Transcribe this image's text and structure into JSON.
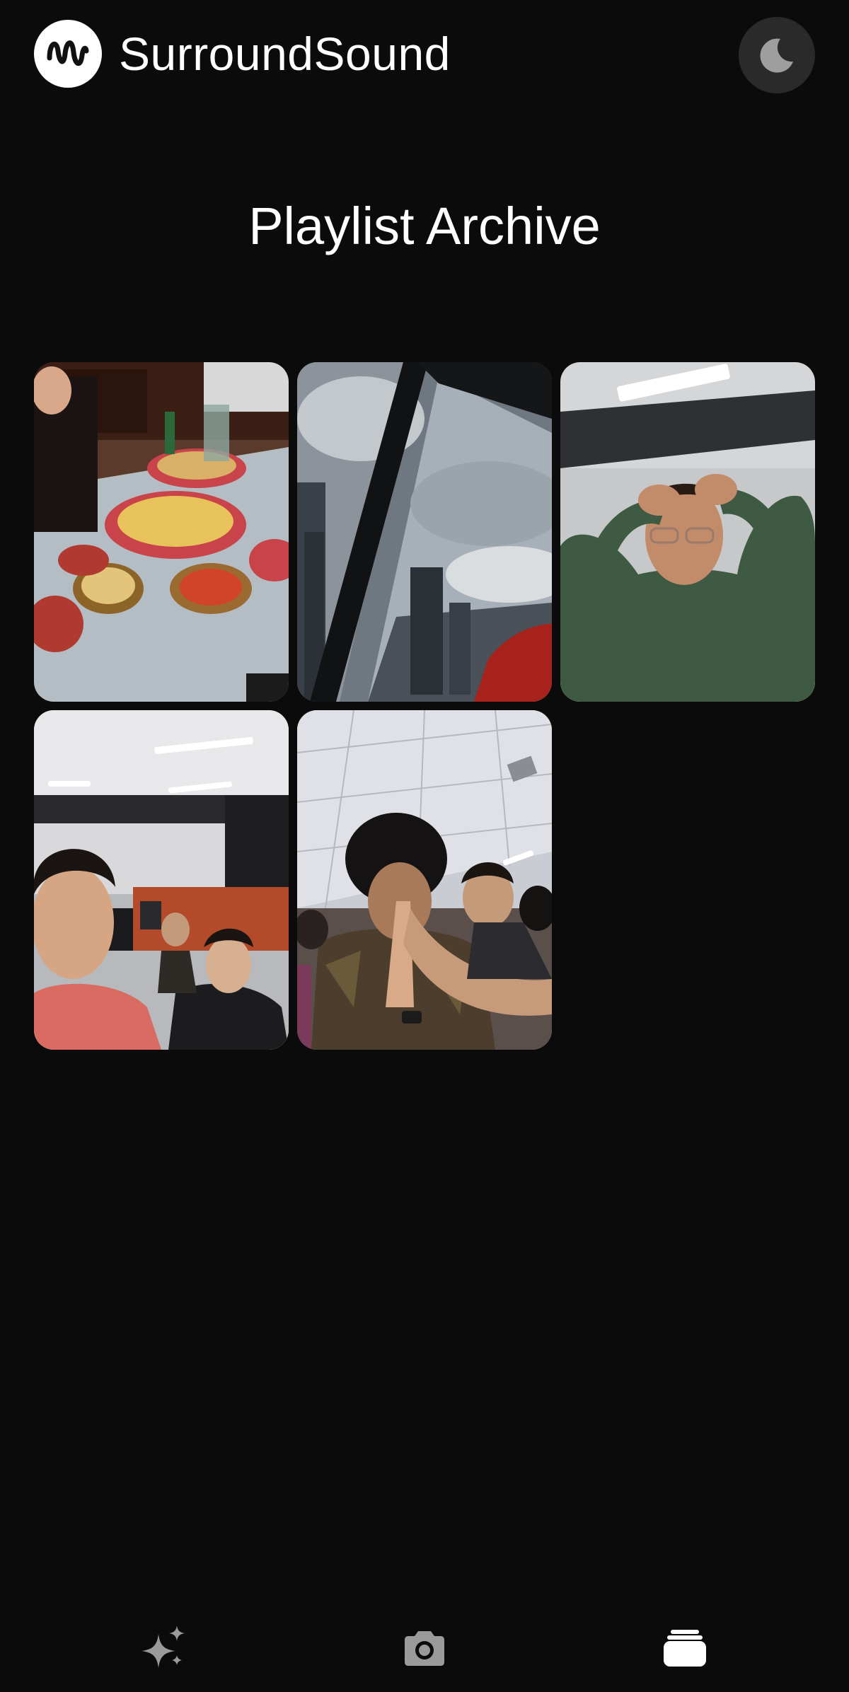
{
  "app": {
    "name": "SurroundSound",
    "logo_icon": "waveform-logo-icon",
    "theme_toggle_icon": "moon-icon"
  },
  "page": {
    "title": "Playlist Archive"
  },
  "archive": {
    "items": [
      {
        "name": "archive-photo-1",
        "subject": "restaurant-table-selfie"
      },
      {
        "name": "archive-photo-2",
        "subject": "city-skyline-window"
      },
      {
        "name": "archive-photo-3",
        "subject": "person-green-sweater"
      },
      {
        "name": "archive-photo-4",
        "subject": "computer-lab-selfie"
      },
      {
        "name": "archive-photo-5",
        "subject": "crowd-praying-hands"
      }
    ]
  },
  "nav": {
    "items": [
      {
        "icon": "sparkles-icon",
        "active": false
      },
      {
        "icon": "camera-icon",
        "active": false
      },
      {
        "icon": "stack-icon",
        "active": true
      }
    ]
  },
  "colors": {
    "background": "#0b0b0b",
    "text": "#ffffff",
    "toggle_bg": "#2a2a2a",
    "nav_inactive": "#9a9a9a",
    "nav_active": "#ffffff"
  }
}
